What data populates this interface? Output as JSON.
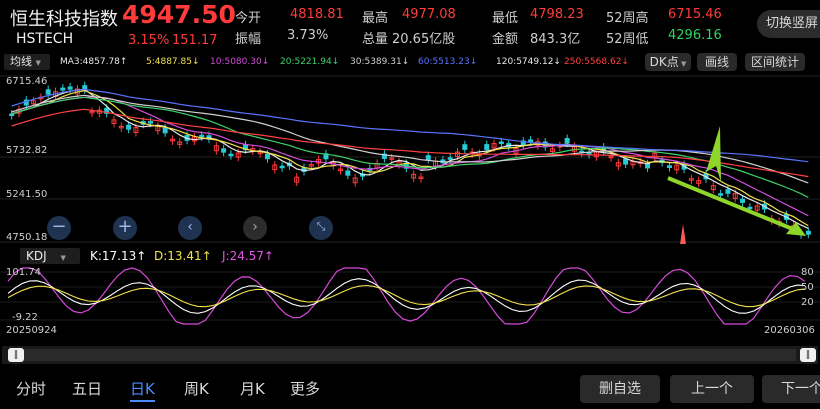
{
  "header": {
    "name": "恒生科技指数",
    "code": "HSTECH",
    "price": "4947.50",
    "change_pct": "3.15%",
    "change": "151.17",
    "open_label": "今开",
    "open": "4818.81",
    "amp_label": "振幅",
    "amp": "3.73%",
    "high_label": "最高",
    "high": "4977.08",
    "vol_label": "总量",
    "vol": "20.65亿股",
    "low_label": "最低",
    "low": "4798.23",
    "amt_label": "金额",
    "amt": "843.3亿",
    "w52h_label": "52周高",
    "w52h": "6715.46",
    "w52l_label": "52周低",
    "w52l": "4296.16",
    "switch_label": "切换竖屏"
  },
  "ma_bar": {
    "selector": "均线",
    "items": [
      {
        "text": "MA3:4857.78↑",
        "color": "#e8e8e8"
      },
      {
        "text": "5:4887.85↓",
        "color": "#f2e24a"
      },
      {
        "text": "10:5080.30↓",
        "color": "#d24ed8"
      },
      {
        "text": "20:5221.94↓",
        "color": "#3fd16a"
      },
      {
        "text": "30:5389.31↓",
        "color": "#d0d0d0"
      },
      {
        "text": "60:5513.23↓",
        "color": "#5a73ff"
      },
      {
        "text": "120:5749.12↓",
        "color": "#e8e8e8"
      },
      {
        "text": "250:5568.62↓",
        "color": "#ff4040"
      }
    ],
    "dk_label": "DK点",
    "draw_label": "画线",
    "interval_label": "区间统计"
  },
  "price_axis": [
    "6715.46",
    "5732.82",
    "5241.50",
    "4750.18"
  ],
  "kdj": {
    "selector": "KDJ",
    "k": "K:17.13↑",
    "d": "D:13.41↑",
    "j": "J:24.57↑",
    "axis_top": "101.74",
    "axis_bottom": "-9.22",
    "right_80": "80",
    "right_50": "50",
    "right_20": "20"
  },
  "dates": {
    "start": "20250924",
    "end": "20260306"
  },
  "bottom_tabs": [
    "分时",
    "五日",
    "日K",
    "周K",
    "月K",
    "更多"
  ],
  "active_tab": "日K",
  "actions": {
    "delete": "删自选",
    "prev": "上一个",
    "next": "下一个"
  },
  "colors": {
    "up": "#ff3b3b",
    "down": "#29c9d6",
    "arrow_red": "#ff5a5a",
    "arrow_green": "#8ed62a"
  }
}
